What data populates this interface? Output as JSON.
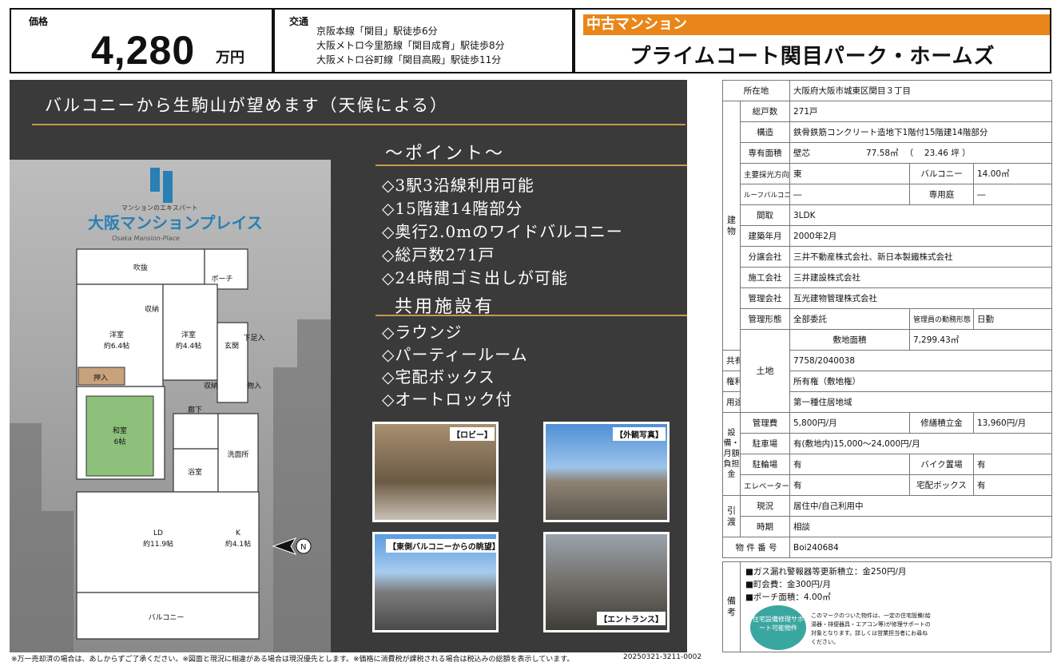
{
  "price": {
    "label": "価格",
    "value": "4,280",
    "unit": "万円"
  },
  "transit": {
    "label": "交通",
    "lines": [
      "京阪本線「関目」駅徒歩6分",
      "大阪メトロ今里筋線「関目成育」駅徒歩8分",
      "大阪メトロ谷町線「関目高殿」駅徒歩11分"
    ]
  },
  "header": {
    "category": "中古マンション",
    "property_name": "プライムコート関目パーク・ホームズ"
  },
  "headline": "バルコニーから生駒山が望めます（天候による）",
  "logo": {
    "tagline": "マンションのエキスパート",
    "name": "大阪マンションプレイス",
    "sub": "Osaka Mansion-Place"
  },
  "floorplan": {
    "rooms": [
      "吹抜",
      "ポーチ",
      "収納",
      "洋室",
      "約6.4帖",
      "洋室",
      "約4.4帖",
      "玄関",
      "下足入",
      "収納",
      "押入",
      "物入",
      "廊下",
      "和室",
      "6帖",
      "洗面所",
      "浴室",
      "LD",
      "約11.9帖",
      "K",
      "約4.1帖",
      "バルコニー"
    ]
  },
  "points": {
    "title": "～ポイント～",
    "items": [
      "◇3駅3沿線利用可能",
      "◇15階建14階部分",
      "◇奥行2.0mのワイドバルコニー",
      "◇総戸数271戸",
      "◇24時間ゴミ出しが可能"
    ]
  },
  "facilities": {
    "title": "共用施設有",
    "items": [
      "◇ラウンジ",
      "◇パーティールーム",
      "◇宅配ボックス",
      "◇オートロック付"
    ]
  },
  "photos": [
    "【ロビー】",
    "【外観写真】",
    "【東側バルコニーからの眺望】",
    "【エントランス】"
  ],
  "table": {
    "address": {
      "k": "所在地",
      "v": "大阪府大阪市城東区関目３丁目"
    },
    "group_building": "建物",
    "total_units": {
      "k": "総戸数",
      "v": "271戸"
    },
    "structure": {
      "k": "構造",
      "v": "鉄骨鉄筋コンクリート造地下1階付15階建14階部分"
    },
    "area": {
      "k": "専有面積",
      "v1": "壁芯",
      "v2": "77.58㎡",
      "v3": "（　 23.46 坪 ）"
    },
    "direction": {
      "k": "主要採光方向",
      "v": "東",
      "k2": "バルコニー",
      "v2": "14.00㎡"
    },
    "roof": {
      "k": "ルーフバルコニー",
      "v": "―",
      "k2": "専用庭",
      "v2": "―"
    },
    "layout": {
      "k": "間取",
      "v": "3LDK"
    },
    "built": {
      "k": "建築年月",
      "v": "2000年2月"
    },
    "seller": {
      "k": "分譲会社",
      "v": "三井不動産株式会社、新日本製鐵株式会社"
    },
    "builder": {
      "k": "施工会社",
      "v": "三井建設株式会社"
    },
    "manager": {
      "k": "管理会社",
      "v": "互光建物管理株式会社"
    },
    "mgmt": {
      "k": "管理形態",
      "v": "全部委託",
      "k2": "管理員の勤務形態",
      "v2": "日勤"
    },
    "group_land": "土地",
    "land_area": {
      "k": "敷地面積",
      "v": "7,299.43㎡"
    },
    "share": {
      "k": "共有持分",
      "v": "7758/2040038"
    },
    "rights": {
      "k": "権利",
      "v": "所有権（敷地権）"
    },
    "zoning": {
      "k": "用途地域",
      "v": "第一種住居地域"
    },
    "group_cost": "設備・月額負担金",
    "mgmt_fee": {
      "k": "管理費",
      "v": "5,800円/月",
      "k2": "修繕積立金",
      "v2": "13,960円/月"
    },
    "parking": {
      "k": "駐車場",
      "v": "有(敷地内)15,000～24,000円/月"
    },
    "bike": {
      "k": "駐輪場",
      "v": "有",
      "k2": "バイク置場",
      "v2": "有"
    },
    "elevator": {
      "k": "エレベーター",
      "v": "有",
      "k2": "宅配ボックス",
      "v2": "有"
    },
    "group_handover": "引渡",
    "status": {
      "k": "現況",
      "v": "居住中/自己利用中"
    },
    "timing": {
      "k": "時期",
      "v": "相談"
    },
    "prop_no": {
      "k": "物 件 番 号",
      "v": "Boi240684"
    }
  },
  "notes": {
    "label": "備考",
    "items": [
      "■ガス漏れ警報器等更新積立：金250円/月",
      "■町会費：金300円/月",
      "■ポーチ面積：4.00㎡"
    ],
    "badge": "住宅設備修理サポート可能物件",
    "badge_text": "このマークのついた物件は、一定の住宅設備(給湯器・排便器具・エアコン等)が修理サポートの対象となります。詳しくは営業担当者にお尋ねください。"
  },
  "footer": {
    "disclaimer": "※万一売却済の場合は、あしからずご了承ください。※図面と現況に相違がある場合は現況優先とします。※価格に消費税が課税される場合は税込みの総額を表示しています。",
    "code": "20250321-3211-0002"
  }
}
